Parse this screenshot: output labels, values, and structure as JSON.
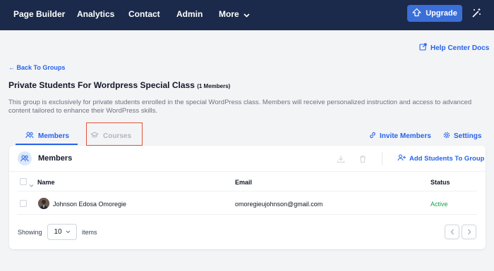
{
  "topnav": {
    "items": [
      "Page Builder",
      "Analytics",
      "Contact",
      "Admin",
      "More"
    ],
    "upgrade_label": "Upgrade"
  },
  "help_link": "Help Center Docs",
  "back_link": "← Back To Groups",
  "page": {
    "title": "Private Students For Wordpress Special Class",
    "member_count": "(1 Members)",
    "description": "This group is exclusively for private students enrolled in the special WordPress class. Members will receive personalized instruction and access to advanced content tailored to enhance their WordPress skills."
  },
  "tabs": {
    "members": "Members",
    "courses": "Courses"
  },
  "actions": {
    "invite": "Invite Members",
    "settings": "Settings"
  },
  "card": {
    "title": "Members",
    "add_students": "Add Students To Group"
  },
  "table": {
    "headers": [
      "Name",
      "Email",
      "Status"
    ],
    "rows": [
      {
        "name": "Johnson Edosa Omoregie",
        "email": "omoregieujohnson@gmail.com",
        "status": "Active"
      }
    ]
  },
  "pagination": {
    "showing": "Showing",
    "per_page": "10",
    "items": "items"
  },
  "colors": {
    "topbar": "#1b2a4a",
    "accent": "#2563eb",
    "active_status": "#16a34a",
    "highlight_box": "#e0533d"
  },
  "icons": [
    "chevron-down-icon",
    "upgrade-icon",
    "magic-wand-icon",
    "external-link-icon",
    "users-icon",
    "graduation-cap-icon",
    "link-icon",
    "gear-icon",
    "download-icon",
    "trash-icon",
    "user-plus-icon",
    "chevron-left-icon",
    "chevron-right-icon"
  ]
}
